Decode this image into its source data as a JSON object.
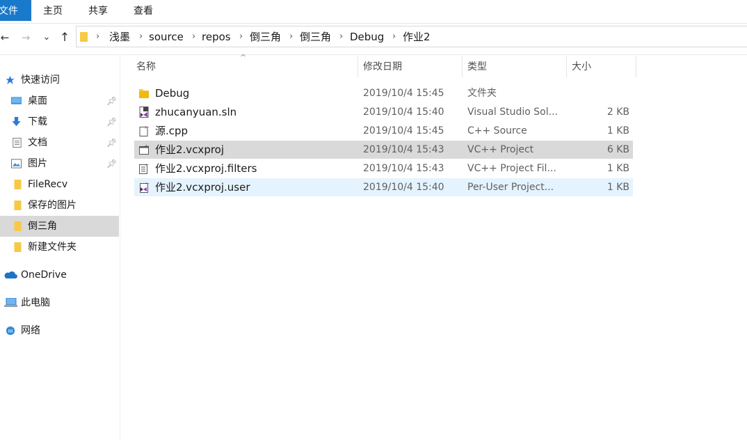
{
  "ribbon": {
    "tabs": [
      "文件",
      "主页",
      "共享",
      "查看"
    ]
  },
  "nav": {
    "back_icon": "←",
    "forward_icon": "→",
    "recent_icon": "⌄",
    "up_icon": "↑"
  },
  "breadcrumb": [
    "浅墨",
    "source",
    "repos",
    "倒三角",
    "倒三角",
    "Debug",
    "作业2"
  ],
  "sidebar": {
    "quick_access": "快速访问",
    "items": [
      {
        "label": "桌面",
        "icon": "desktop-icon",
        "pinned": true
      },
      {
        "label": "下载",
        "icon": "download-icon",
        "pinned": true
      },
      {
        "label": "文档",
        "icon": "document-icon",
        "pinned": true
      },
      {
        "label": "图片",
        "icon": "pictures-icon",
        "pinned": true
      },
      {
        "label": "FileRecv",
        "icon": "folder-icon",
        "pinned": false
      },
      {
        "label": "保存的图片",
        "icon": "folder-icon",
        "pinned": false
      },
      {
        "label": "倒三角",
        "icon": "folder-icon",
        "pinned": false,
        "selected": true
      },
      {
        "label": "新建文件夹",
        "icon": "folder-icon",
        "pinned": false
      }
    ],
    "onedrive": "OneDrive",
    "this_pc": "此电脑",
    "network": "网络"
  },
  "columns": {
    "name": "名称",
    "date": "修改日期",
    "type": "类型",
    "size": "大小"
  },
  "files": [
    {
      "name": "Debug",
      "date": "2019/10/4 15:45",
      "type": "文件夹",
      "size": "",
      "icon": "folder-icon"
    },
    {
      "name": "zhucanyuan.sln",
      "date": "2019/10/4 15:40",
      "type": "Visual Studio Sol...",
      "size": "2 KB",
      "icon": "vs-solution-icon"
    },
    {
      "name": "源.cpp",
      "date": "2019/10/4 15:45",
      "type": "C++ Source",
      "size": "1 KB",
      "icon": "cpp-file-icon"
    },
    {
      "name": "作业2.vcxproj",
      "date": "2019/10/4 15:43",
      "type": "VC++ Project",
      "size": "6 KB",
      "icon": "vcxproj-icon",
      "state": "selected"
    },
    {
      "name": "作业2.vcxproj.filters",
      "date": "2019/10/4 15:43",
      "type": "VC++ Project Fil...",
      "size": "1 KB",
      "icon": "filters-icon"
    },
    {
      "name": "作业2.vcxproj.user",
      "date": "2019/10/4 15:40",
      "type": "Per-User Project...",
      "size": "1 KB",
      "icon": "user-project-icon",
      "state": "hover"
    }
  ],
  "colors": {
    "file_tab": "#1979ca",
    "selected_row": "#d9d9d9",
    "hover_row": "#e5f3ff",
    "folder": "#f7c948",
    "vs_purple": "#68217a"
  }
}
